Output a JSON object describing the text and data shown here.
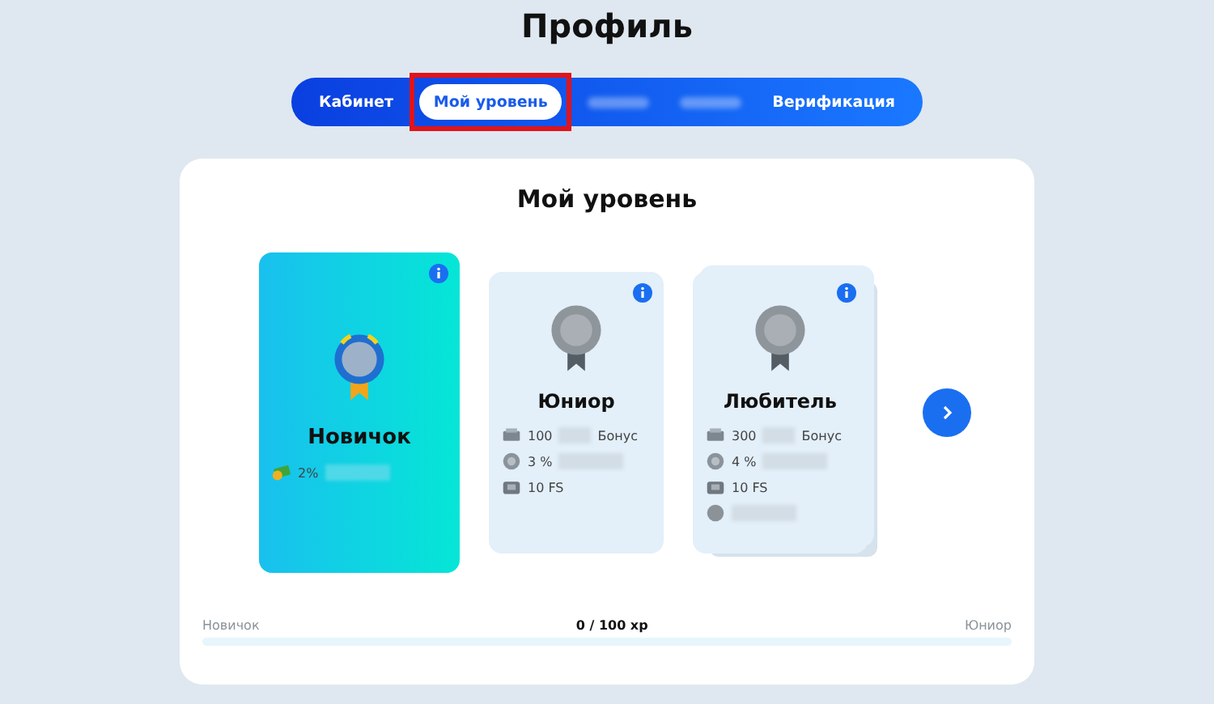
{
  "page_title": "Профиль",
  "tabs": [
    {
      "label": "Кабинет",
      "selected": false,
      "redacted": false
    },
    {
      "label": "Мой уровень",
      "selected": true,
      "redacted": false,
      "highlighted": true
    },
    {
      "selected": false,
      "redacted": true
    },
    {
      "selected": false,
      "redacted": true
    },
    {
      "label": "Верификация",
      "selected": false,
      "redacted": false
    }
  ],
  "panel": {
    "title": "Мой уровень",
    "levels": [
      {
        "name": "Новичок",
        "selected": true,
        "rewards": [
          {
            "kind": "value-blur",
            "value": "2%"
          }
        ]
      },
      {
        "name": "Юниор",
        "selected": false,
        "rewards": [
          {
            "kind": "value-blur-label",
            "value": "100",
            "label": "Бонус"
          },
          {
            "kind": "value-blur",
            "value": "3 %"
          },
          {
            "kind": "value",
            "value": "10 FS"
          }
        ]
      },
      {
        "name": "Любитель",
        "selected": false,
        "stacked": true,
        "rewards": [
          {
            "kind": "value-blur-label",
            "value": "300",
            "label": "Бонус"
          },
          {
            "kind": "value-blur",
            "value": "4 %"
          },
          {
            "kind": "value",
            "value": "10 FS"
          },
          {
            "kind": "blur"
          }
        ]
      }
    ],
    "progress": {
      "from": "Новичок",
      "reading": "0 / 100 xp",
      "to": "Юниор",
      "level": 0
    }
  }
}
